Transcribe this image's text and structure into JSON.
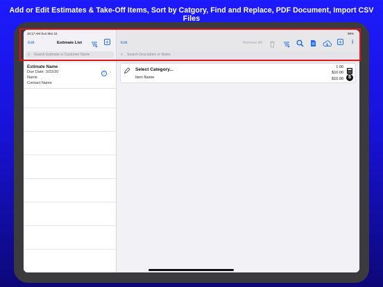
{
  "banner": "Add or Edit Estimates & Take-Off Items, Sort by Catgory, Find and Replace, PDF Document, Import CSV Files",
  "status_bar": {
    "time": "10:17 AM   Sun Mar 22",
    "battery": "95%"
  },
  "left_pane": {
    "edit_label": "Edit",
    "title": "Estimate List",
    "search_placeholder": "Search Estimate or Customer Name",
    "estimate": {
      "title": "Estimate Name",
      "due_date": "Due Date:  3/22/20",
      "name": "Name",
      "contact": "Contact Name"
    }
  },
  "right_pane": {
    "edit_label": "Edit",
    "remove_all_label": "Remove All",
    "search_placeholder": "Search Description or Notes",
    "item": {
      "category": "Select Category...",
      "item_name": "Item Name",
      "quantity": "1.00",
      "price": "$10.00",
      "total": "$10.00"
    }
  },
  "colors": {
    "accent": "#1a6cf0",
    "highlight": "#e0141b",
    "background": "#1d1bff"
  },
  "icons": [
    "sort-icon",
    "plus-icon",
    "trash-icon",
    "search-icon",
    "document-icon",
    "cloud-import-icon",
    "info-icon",
    "pencil-icon",
    "calculator-icon",
    "dollar-icon"
  ]
}
